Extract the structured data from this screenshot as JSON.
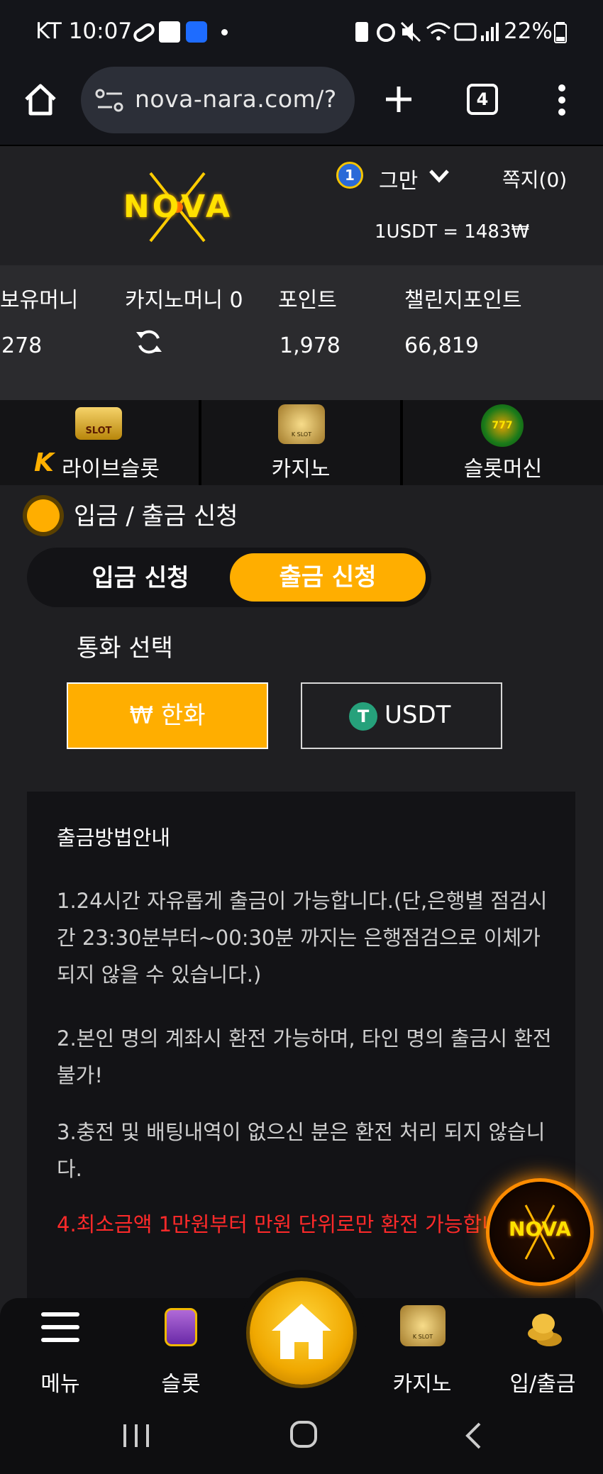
{
  "status_bar": {
    "carrier_time": "KT 10:07",
    "battery": "22%"
  },
  "browser": {
    "url": "nova-nara.com/?",
    "tab_count": "4"
  },
  "header": {
    "logo_text": "NOVA",
    "level": "1",
    "username": "그만",
    "messages": "쪽지(0)",
    "exchange_rate": "1USDT = 1483₩"
  },
  "balances": {
    "holding_label": "보유머니",
    "holding_value": "278",
    "casino_label": "카지노머니 0",
    "points_label": "포인트",
    "points_value": "1,978",
    "challenge_label": "챌린지포인트",
    "challenge_value": "66,819"
  },
  "game_tabs": [
    {
      "label": "라이브슬롯",
      "badge": "K",
      "icon_text": "SLOT"
    },
    {
      "label": "카지노",
      "icon_text": "K SLOT"
    },
    {
      "label": "슬롯머신",
      "icon_text": "777"
    }
  ],
  "section": {
    "title": "입금 / 출금 신청"
  },
  "toggle": {
    "deposit": "입금 신청",
    "withdraw": "출금 신청"
  },
  "currency": {
    "label": "통화 선택",
    "krw": "₩ 한화",
    "usdt_symbol": "T",
    "usdt": "USDT"
  },
  "guide": {
    "title": "출금방법안내",
    "item1": "1.24시간 자유롭게 출금이 가능합니다.(단,은행별 점검시간 23:30분부터~00:30분 까지는 은행점검으로 이체가 되지 않을 수 있습니다.)",
    "item2": "2.본인 명의 계좌시 환전 가능하며, 타인 명의 출금시 환전 불가!",
    "item3": "3.충전 및 배팅내역이 없으신 분은 환전 처리 되지 않습니다.",
    "item4": "4.최소금액 1만원부터 만원 단위로만 환전 가능합니다."
  },
  "bottom_nav": [
    {
      "label": "메뉴"
    },
    {
      "label": "슬롯"
    },
    {
      "label": "카지노"
    },
    {
      "label": "입/출금"
    }
  ],
  "colors": {
    "accent": "#ffae00",
    "warning": "#ff2a2a",
    "background": "#1f1f22",
    "usdt_green": "#26a17b"
  }
}
